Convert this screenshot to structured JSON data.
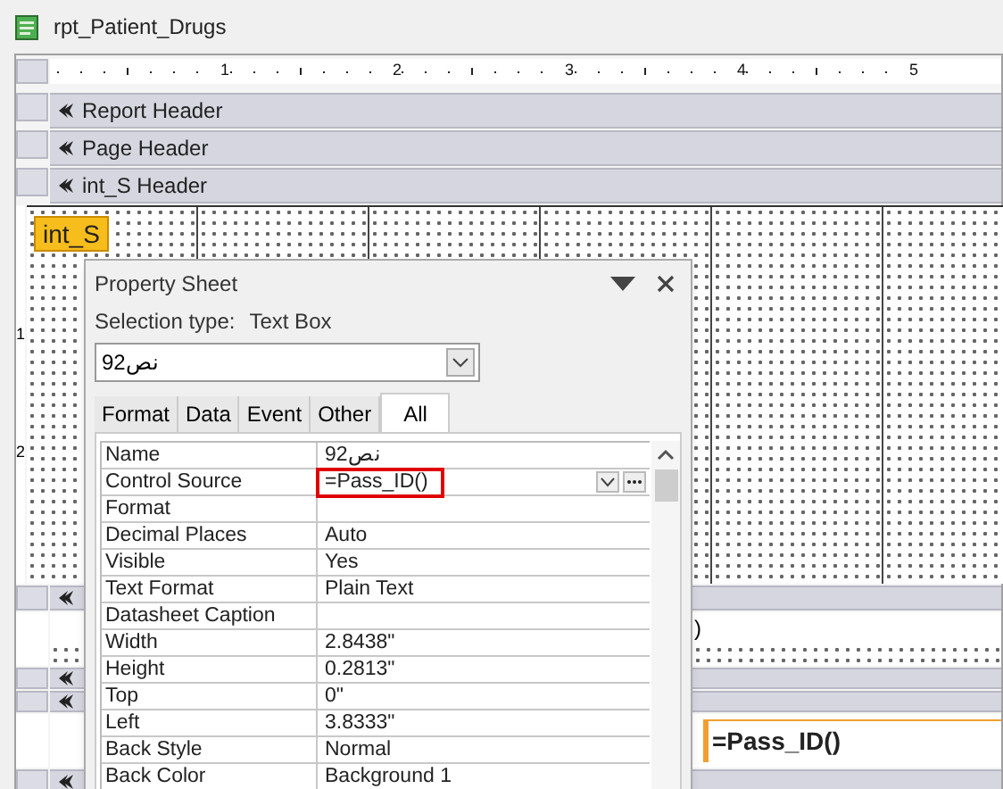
{
  "window": {
    "title": "rpt_Patient_Drugs"
  },
  "ruler": {
    "horizontal": [
      "1",
      "2",
      "3",
      "4",
      "5"
    ],
    "vertical": [
      "1",
      "2"
    ]
  },
  "sections": [
    {
      "label": "Report Header"
    },
    {
      "label": "Page Header"
    },
    {
      "label": "int_S Header"
    }
  ],
  "detail": {
    "label": "int_S"
  },
  "footer": {
    "partial_text": ")",
    "control_text": "=Pass_ID()"
  },
  "property_sheet": {
    "title": "Property Sheet",
    "selection_type_label": "Selection type:",
    "selection_type": "Text Box",
    "object": "نص92",
    "tabs": [
      {
        "label": "Format",
        "selected": false
      },
      {
        "label": "Data",
        "selected": false
      },
      {
        "label": "Event",
        "selected": false
      },
      {
        "label": "Other",
        "selected": false
      },
      {
        "label": "All",
        "selected": true
      }
    ],
    "rows": [
      {
        "name": "Name",
        "value": "نص92",
        "kind": "text",
        "highlighted": false
      },
      {
        "name": "Control Source",
        "value": "=Pass_ID()",
        "kind": "builder",
        "highlighted": true
      },
      {
        "name": "Format",
        "value": "",
        "kind": "text",
        "highlighted": false
      },
      {
        "name": "Decimal Places",
        "value": "Auto",
        "kind": "text",
        "highlighted": false
      },
      {
        "name": "Visible",
        "value": "Yes",
        "kind": "text",
        "highlighted": false
      },
      {
        "name": "Text Format",
        "value": "Plain Text",
        "kind": "text",
        "highlighted": false
      },
      {
        "name": "Datasheet Caption",
        "value": "",
        "kind": "text",
        "highlighted": false
      },
      {
        "name": "Width",
        "value": "2.8438\"",
        "kind": "text",
        "highlighted": false
      },
      {
        "name": "Height",
        "value": "0.2813\"",
        "kind": "text",
        "highlighted": false
      },
      {
        "name": "Top",
        "value": "0\"",
        "kind": "text",
        "highlighted": false
      },
      {
        "name": "Left",
        "value": "3.8333\"",
        "kind": "text",
        "highlighted": false
      },
      {
        "name": "Back Style",
        "value": "Normal",
        "kind": "text",
        "highlighted": false
      },
      {
        "name": "Back Color",
        "value": "Background 1",
        "kind": "text",
        "highlighted": false
      }
    ]
  }
}
